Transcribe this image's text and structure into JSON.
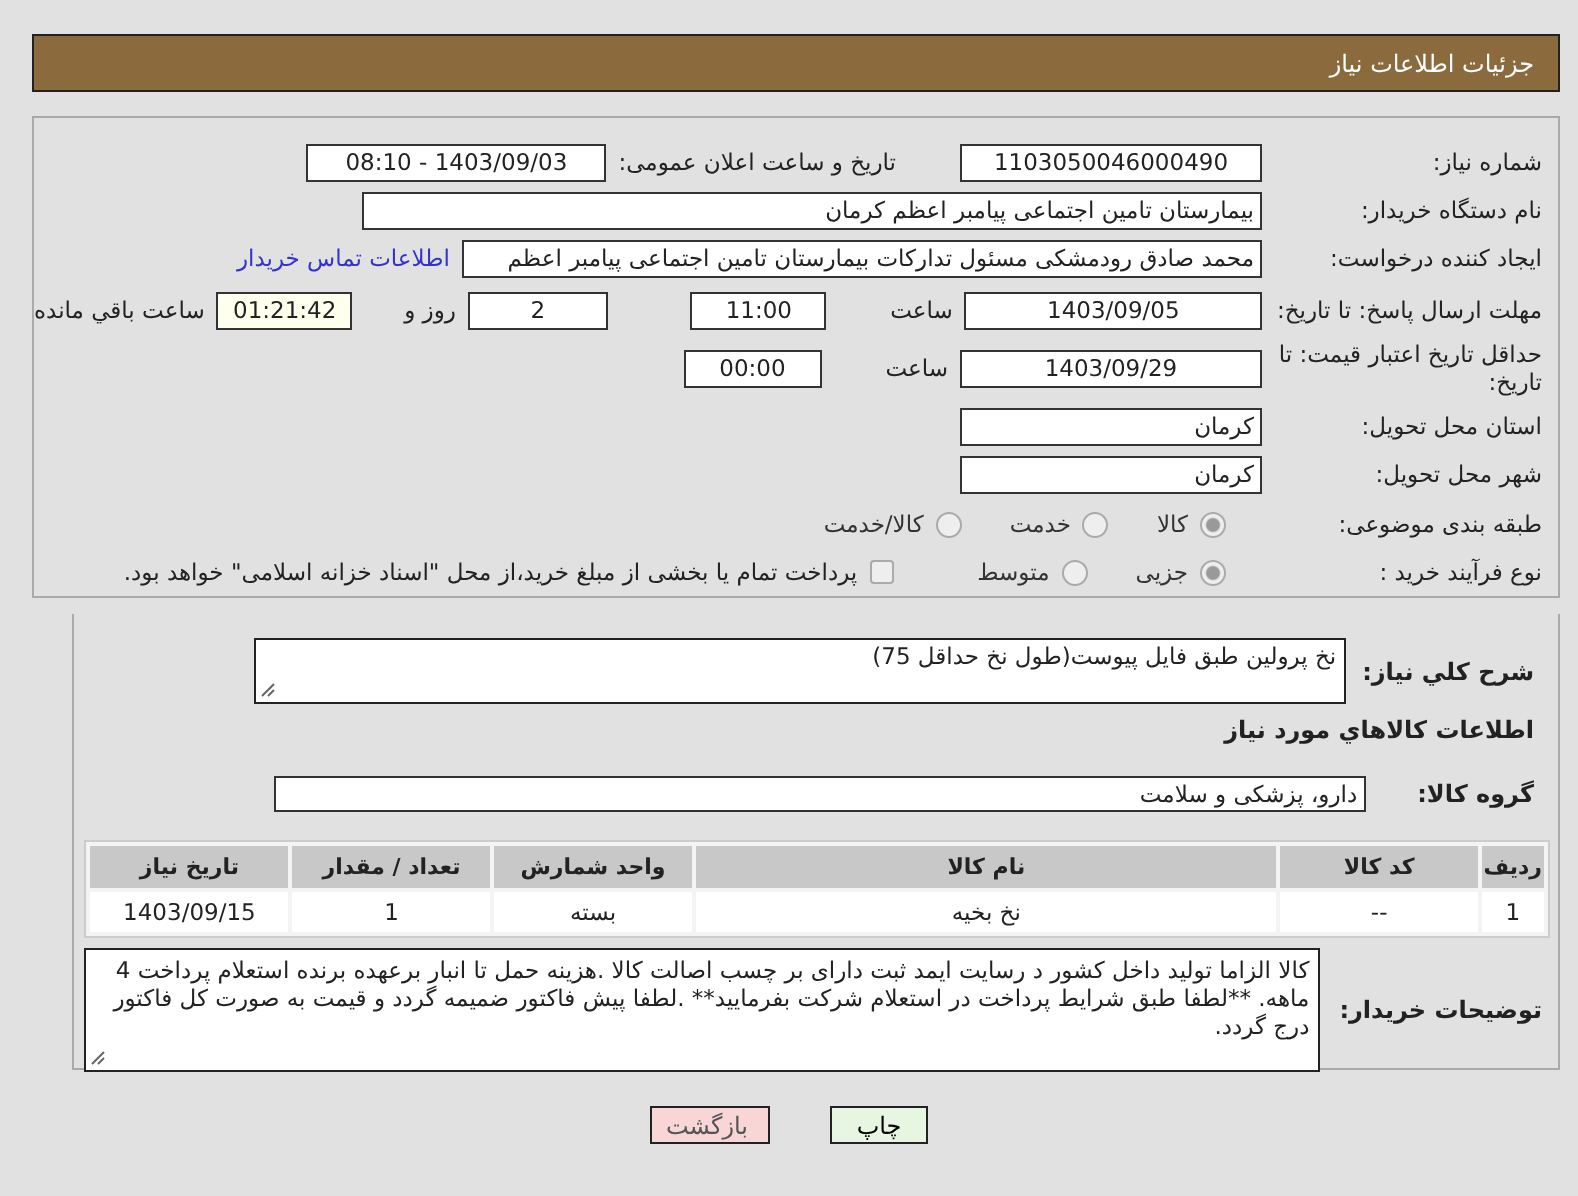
{
  "header": {
    "title": "جزئیات اطلاعات نیاز"
  },
  "need": {
    "number_label": "شماره نیاز:",
    "number": "1103050046000490",
    "announce_label": "تاریخ و ساعت اعلان عمومی:",
    "announce": "1403/09/03 - 08:10",
    "buyer_label": "نام دستگاه خریدار:",
    "buyer": "بیمارستان تامین اجتماعی پیامبر اعظم کرمان",
    "creator_label": "ایجاد کننده درخواست:",
    "creator": "محمد صادق  رودمشکی مسئول تدارکات بیمارستان تامین اجتماعی پیامبر اعظم",
    "contact_link": "اطلاعات تماس خریدار",
    "deadline_label": "مهلت ارسال پاسخ: تا تاریخ:",
    "deadline_date": "1403/09/05",
    "hour_label": "ساعت",
    "deadline_time": "11:00",
    "days": "2",
    "days_label": "روز و",
    "remaining": "01:21:42",
    "remaining_label": "ساعت باقي مانده",
    "validity_label": "حداقل تاریخ اعتبار قیمت: تا تاریخ:",
    "validity_date": "1403/09/29",
    "validity_hour_label": "ساعت",
    "validity_time": "00:00",
    "province_label": "استان محل تحویل:",
    "province": "کرمان",
    "city_label": "شهر محل تحویل:",
    "city": "کرمان",
    "category_label": "طبقه بندی موضوعی:",
    "categories": [
      {
        "label": "کالا",
        "selected": true
      },
      {
        "label": "خدمت",
        "selected": false
      },
      {
        "label": "کالا/خدمت",
        "selected": false
      }
    ],
    "process_label": "نوع فرآیند خرید :",
    "processes": [
      {
        "label": "جزیی",
        "selected": true
      },
      {
        "label": "متوسط",
        "selected": false
      }
    ],
    "treasury": {
      "checked": false,
      "label": "پرداخت تمام یا بخشی از مبلغ خرید،از محل \"اسناد خزانه اسلامی\" خواهد بود."
    }
  },
  "items": {
    "summary_label": "شرح کلي نياز:",
    "summary": "نخ پرولین طبق فایل پیوست(طول نخ حداقل 75)",
    "section_title": "اطلاعات كالاهاي مورد نياز",
    "group_label": "گروه کالا:",
    "group": "دارو، پزشکی و سلامت",
    "table": {
      "columns": [
        "ردیف",
        "کد کالا",
        "نام کالا",
        "واحد شمارش",
        "تعداد / مقدار",
        "تاریخ نیاز"
      ],
      "rows": [
        [
          "1",
          "--",
          "نخ بخیه",
          "بسته",
          "1",
          "1403/09/15"
        ]
      ]
    },
    "notes_label": "توضیحات خریدار:",
    "notes": "کالا الزاما تولید داخل کشور د رسایت ایمد ثبت دارای بر چسب اصالت کالا .هزینه حمل تا انبار برعهده برنده استعلام پرداخت 4 ماهه. **لطفا طبق شرایط پرداخت در استعلام شرکت بفرمایید** .لطفا پیش فاکتور ضمیمه گردد و قیمت به صورت کل فاکتور درج گردد."
  },
  "buttons": [
    {
      "kind": "print",
      "label": "چاپ"
    },
    {
      "kind": "back",
      "label": "بازگشت"
    }
  ]
}
